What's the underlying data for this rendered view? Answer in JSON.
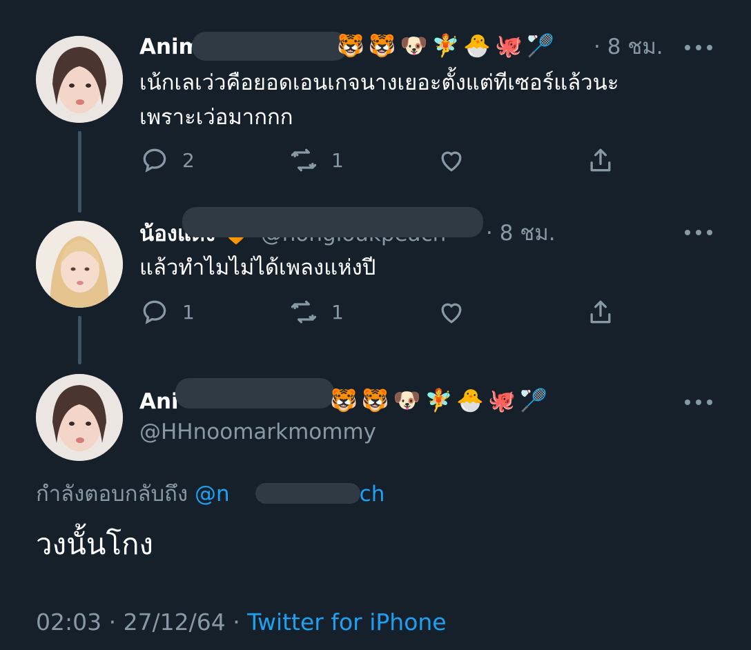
{
  "tweet1": {
    "name": "Anim",
    "emojis": "🐯🐯🐶🧚🐣🐙🏸",
    "time": "· 8 ชม.",
    "text_lines": [
      "เน้กเลเว่วคือยอดเอนเกจนางเยอะตั้งแต่ทีเซอร์แล้วนะ",
      "เพราะเว่อมากกก"
    ],
    "reply_count": "2",
    "retweet_count": "1"
  },
  "tweet2": {
    "name": "น้องแดง",
    "emojis": "🧡",
    "handle_partial": "@nongloukpeach",
    "time": "· 8 ชม.",
    "text": "แล้วทำไมไม่ได้เพลงแห่งปี",
    "reply_count": "1",
    "retweet_count": "1"
  },
  "main_tweet": {
    "name": "Ani",
    "emojis": "🐯🐯🐶🧚🐣🐙🏸",
    "handle": "@HHnoomarkmommy",
    "replying_prefix": "กำลังตอบกลับถึง",
    "replying_mention_start": "@n",
    "replying_mention_end": "each",
    "text": "วงนั้นโกง",
    "timestamp": "02:03 · 27/12/64 ·",
    "source": "Twitter for iPhone"
  },
  "colors": {
    "background": "#15202b",
    "secondary_text": "#8899a6",
    "accent": "#1da1f2",
    "thread_line": "#3d5466",
    "redaction": "#2f3a45"
  },
  "icons": {
    "reply": "reply-icon",
    "retweet": "retweet-icon",
    "like": "heart-icon",
    "share": "share-icon",
    "more": "more-icon"
  }
}
